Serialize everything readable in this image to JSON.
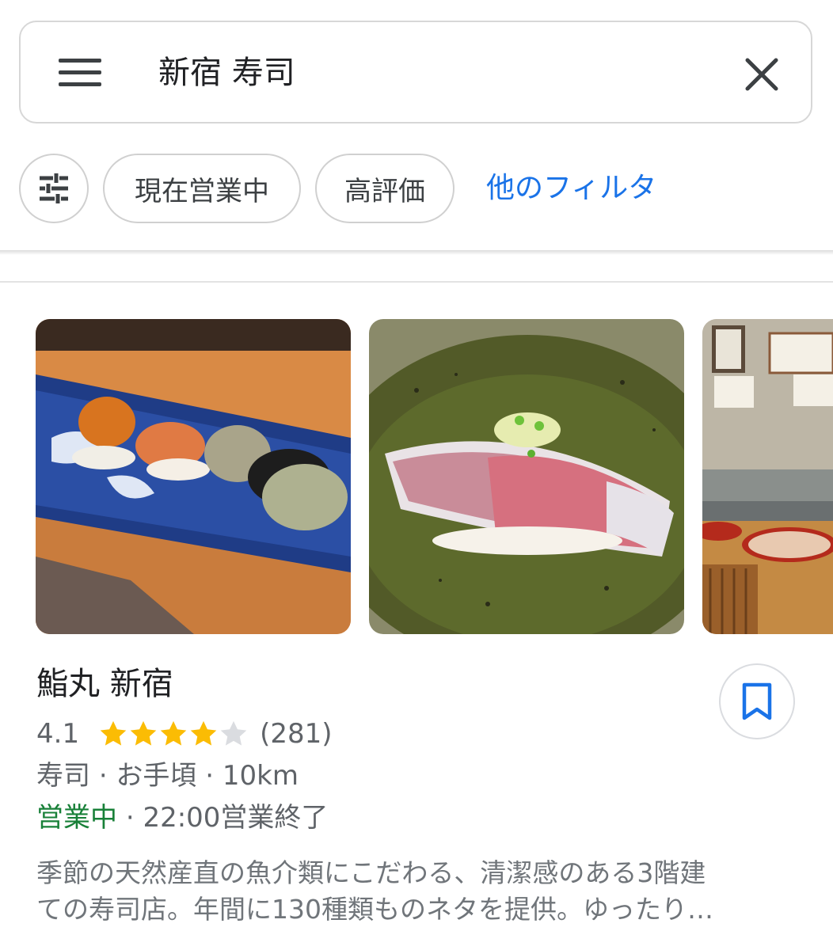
{
  "search": {
    "query": "新宿 寿司"
  },
  "chips": {
    "open_now": "現在営業中",
    "top_rated": "高評価",
    "more_filters": "他のフィルタ"
  },
  "listing": {
    "name": "鮨丸 新宿",
    "rating": "4.1",
    "rating_value": 4.1,
    "rating_max": 5,
    "review_count": "(281)",
    "category": "寿司",
    "price": "お手頃",
    "distance": "10km",
    "open_status": "営業中",
    "closing_time": "22:00営業終了",
    "description_line1": "季節の天然産直の魚介類にこだわる、清潔感のある3階建",
    "description_line2": "ての寿司店。年間に130種類ものネタを提供。ゆったり…",
    "separator": "·"
  },
  "colors": {
    "accent": "#1a73e8",
    "open": "#188038",
    "star": "#fbbc04",
    "star_empty": "#dadce0"
  }
}
